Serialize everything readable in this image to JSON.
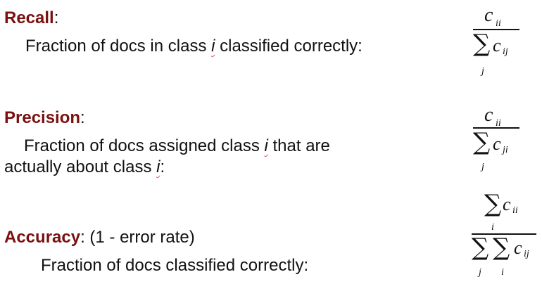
{
  "recall": {
    "heading": "Recall",
    "colon": ":",
    "line1_pre": "Fraction of docs in class ",
    "var": "i",
    "line1_post": " classified correctly:",
    "numerator": "c",
    "numerator_sub": "ii",
    "denom_sum_index": "j",
    "denom_c": "c",
    "denom_sub": "ij"
  },
  "precision": {
    "heading": "Precision",
    "colon": ":",
    "line1_pre": "Fraction of docs assigned class ",
    "var1": "i",
    "line1_post": " that are",
    "line2_pre": "actually about class ",
    "var2": "i",
    "line2_post": ":",
    "numerator": "c",
    "numerator_sub": "ii",
    "denom_sum_index": "j",
    "denom_c": "c",
    "denom_sub": "ji"
  },
  "accuracy": {
    "heading": "Accuracy",
    "suffix": ": (1 - error rate)",
    "line1": "Fraction of docs classified correctly:",
    "num_sum_index": "i",
    "numerator": "c",
    "numerator_sub": "ii",
    "denom_index_outer": "j",
    "denom_index_inner": "i",
    "denom_c": "c",
    "denom_sub": "ij"
  }
}
